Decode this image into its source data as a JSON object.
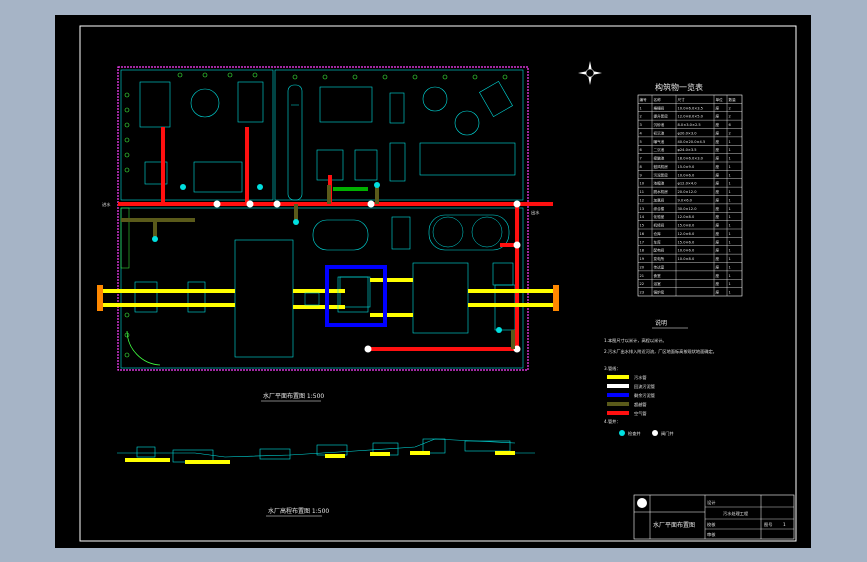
{
  "colors": {
    "background": "#a6b4c6",
    "sheet": "#000000",
    "frame": "#ffffff",
    "structure": "#00e0e0",
    "site_boundary": "#ff40ff",
    "red_pipe": "#ff1010",
    "yellow_pipe": "#ffff00",
    "blue_pipe": "#0000ff",
    "olive_pipe": "#5a5a1a",
    "tree": "#40ff40"
  },
  "plan": {
    "title": "水厂平面布置图 1:500",
    "inlet_label": "进水",
    "outlet_label": "出水"
  },
  "profile": {
    "title": "水厂高程布置图 1:500"
  },
  "schedule": {
    "title": "构筑物一览表",
    "headers": [
      "编号",
      "名称",
      "尺寸",
      "单位",
      "数量"
    ],
    "rows": [
      {
        "no": "1",
        "name": "格栅间",
        "size": "10.0×6.0×3.5",
        "unit": "座",
        "qty": "2"
      },
      {
        "no": "2",
        "name": "提升泵房",
        "size": "12.0×8.0×5.0",
        "unit": "座",
        "qty": "2"
      },
      {
        "no": "3",
        "name": "沉砂池",
        "size": "8.0×3.0×2.5",
        "unit": "座",
        "qty": "6"
      },
      {
        "no": "4",
        "name": "初沉池",
        "size": "φ20.0×3.0",
        "unit": "座",
        "qty": "2"
      },
      {
        "no": "5",
        "name": "曝气池",
        "size": "40.0×20.0×4.5",
        "unit": "座",
        "qty": "1"
      },
      {
        "no": "6",
        "name": "二沉池",
        "size": "φ24.0×3.5",
        "unit": "座",
        "qty": "1"
      },
      {
        "no": "7",
        "name": "接触池",
        "size": "18.0×6.0×3.0",
        "unit": "座",
        "qty": "1"
      },
      {
        "no": "8",
        "name": "鼓风机房",
        "size": "15.0×9.0",
        "unit": "座",
        "qty": "1"
      },
      {
        "no": "9",
        "name": "污泥泵房",
        "size": "10.0×6.0",
        "unit": "座",
        "qty": "1"
      },
      {
        "no": "10",
        "name": "浓缩池",
        "size": "φ12.0×4.0",
        "unit": "座",
        "qty": "1"
      },
      {
        "no": "11",
        "name": "脱水机房",
        "size": "20.0×12.0",
        "unit": "座",
        "qty": "1"
      },
      {
        "no": "12",
        "name": "加氯间",
        "size": "9.0×6.0",
        "unit": "座",
        "qty": "1"
      },
      {
        "no": "13",
        "name": "综合楼",
        "size": "30.0×12.0",
        "unit": "座",
        "qty": "1"
      },
      {
        "no": "14",
        "name": "化验室",
        "size": "12.0×8.0",
        "unit": "座",
        "qty": "1"
      },
      {
        "no": "15",
        "name": "机修间",
        "size": "15.0×8.0",
        "unit": "座",
        "qty": "1"
      },
      {
        "no": "16",
        "name": "仓库",
        "size": "12.0×6.0",
        "unit": "座",
        "qty": "1"
      },
      {
        "no": "17",
        "name": "车库",
        "size": "15.0×6.0",
        "unit": "座",
        "qty": "1"
      },
      {
        "no": "18",
        "name": "配电间",
        "size": "10.0×6.0",
        "unit": "座",
        "qty": "1"
      },
      {
        "no": "19",
        "name": "变电所",
        "size": "10.0×8.0",
        "unit": "座",
        "qty": "1"
      },
      {
        "no": "20",
        "name": "传达室",
        "size": "",
        "unit": "座",
        "qty": "1"
      },
      {
        "no": "21",
        "name": "食堂",
        "size": "",
        "unit": "座",
        "qty": "1"
      },
      {
        "no": "22",
        "name": "浴室",
        "size": "",
        "unit": "座",
        "qty": "1"
      },
      {
        "no": "23",
        "name": "锅炉房",
        "size": "",
        "unit": "座",
        "qty": "1"
      }
    ]
  },
  "notes": {
    "title": "说明",
    "lines": [
      "1.本图尺寸以米计，高程以米计。",
      "2.污水厂出水排入附近河流，厂区地面标高按现状地面确定。",
      "3.管线："
    ],
    "legend": [
      {
        "label": "污水管",
        "color": "#ffff00"
      },
      {
        "label": "回流污泥管",
        "color": "#ffffff"
      },
      {
        "label": "剩余污泥管",
        "color": "#0000ff"
      },
      {
        "label": "超越管",
        "color": "#5a5a1a"
      },
      {
        "label": "空气管",
        "color": "#ff1010"
      }
    ],
    "well_title": "4.管井：",
    "wells": [
      {
        "label": "检查井",
        "color": "#00e0e0"
      },
      {
        "label": "阀门井",
        "color": "#ffffff"
      }
    ]
  },
  "title_block": {
    "drawing_name": "水厂平面布置图",
    "project": "污水处理工程",
    "fields": [
      "设计",
      "校核",
      "审核"
    ],
    "sheet_label": "图号",
    "sheet_value": "1"
  }
}
